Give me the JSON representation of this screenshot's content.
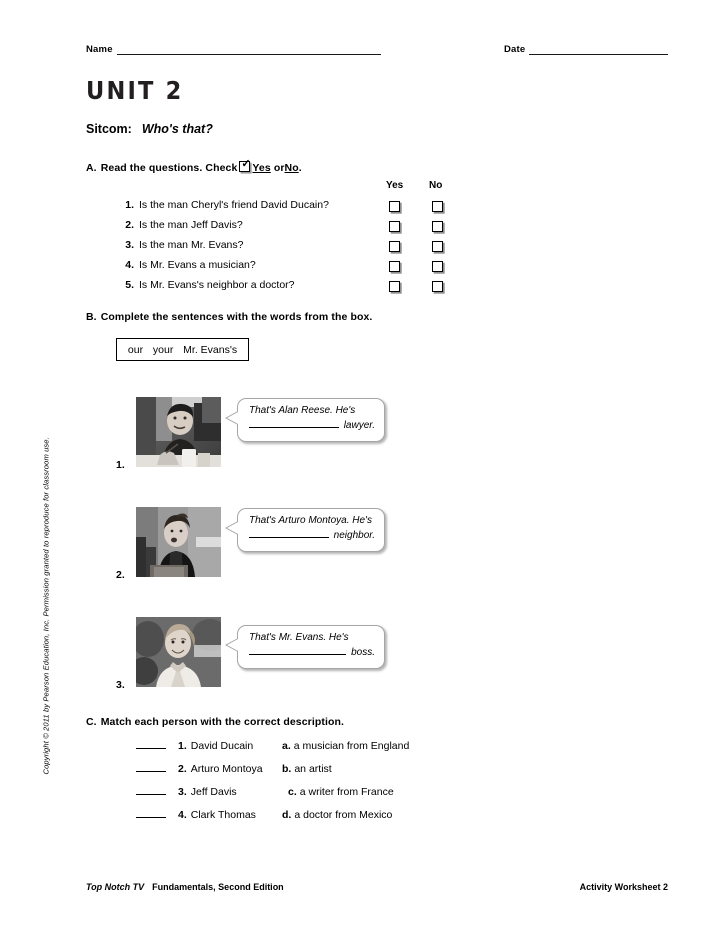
{
  "header": {
    "name_label": "Name",
    "date_label": "Date"
  },
  "unit": {
    "title": "UNIT 2",
    "sitcom_label": "Sitcom:",
    "sitcom_title": "Who's that?"
  },
  "section_a": {
    "letter": "A.",
    "instruction_pre": "Read the questions. Check",
    "instruction_yes": "Yes",
    "instruction_or": "or",
    "instruction_no": "No",
    "instruction_end": ".",
    "col_yes": "Yes",
    "col_no": "No",
    "questions": [
      {
        "num": "1.",
        "text": "Is the man Cheryl's friend David Ducain?"
      },
      {
        "num": "2.",
        "text": "Is the man Jeff Davis?"
      },
      {
        "num": "3.",
        "text": "Is the man Mr. Evans?"
      },
      {
        "num": "4.",
        "text": "Is Mr. Evans a musician?"
      },
      {
        "num": "5.",
        "text": "Is Mr. Evans's neighbor a doctor?"
      }
    ]
  },
  "section_b": {
    "letter": "B.",
    "instruction": "Complete the sentences with the words from the box.",
    "word_bank": [
      "our",
      "your",
      "Mr. Evans's"
    ],
    "items": [
      {
        "num": "1.",
        "line1": "That's Alan Reese.  He's",
        "line2_word": "lawyer.",
        "photo_alt": "man-smiling-at-table"
      },
      {
        "num": "2.",
        "line1": "That's Arturo Montoya.  He's",
        "line2_word": "neighbor.",
        "photo_alt": "woman-with-updo-hair"
      },
      {
        "num": "3.",
        "line1": "That's Mr. Evans. He's",
        "line2_word": "boss.",
        "photo_alt": "smiling-blonde-woman"
      }
    ]
  },
  "section_c": {
    "letter": "C.",
    "instruction": "Match each person with the correct description.",
    "people": [
      {
        "num": "1.",
        "name": "David Ducain"
      },
      {
        "num": "2.",
        "name": "Arturo Montoya"
      },
      {
        "num": "3.",
        "name": "Jeff Davis"
      },
      {
        "num": "4.",
        "name": "Clark Thomas"
      }
    ],
    "descriptions": [
      {
        "letter": "a.",
        "text": "a musician from England"
      },
      {
        "letter": "b.",
        "text": "an artist"
      },
      {
        "letter": "c.",
        "text": "a writer from France"
      },
      {
        "letter": "d.",
        "text": "a doctor from Mexico"
      }
    ]
  },
  "copyright": "Copyright © 2011 by Pearson Education, Inc. Permission granted to reproduce for classroom use.",
  "footer": {
    "series": "Top Notch TV",
    "edition": "Fundamentals, Second Edition",
    "right": "Activity Worksheet 2"
  }
}
